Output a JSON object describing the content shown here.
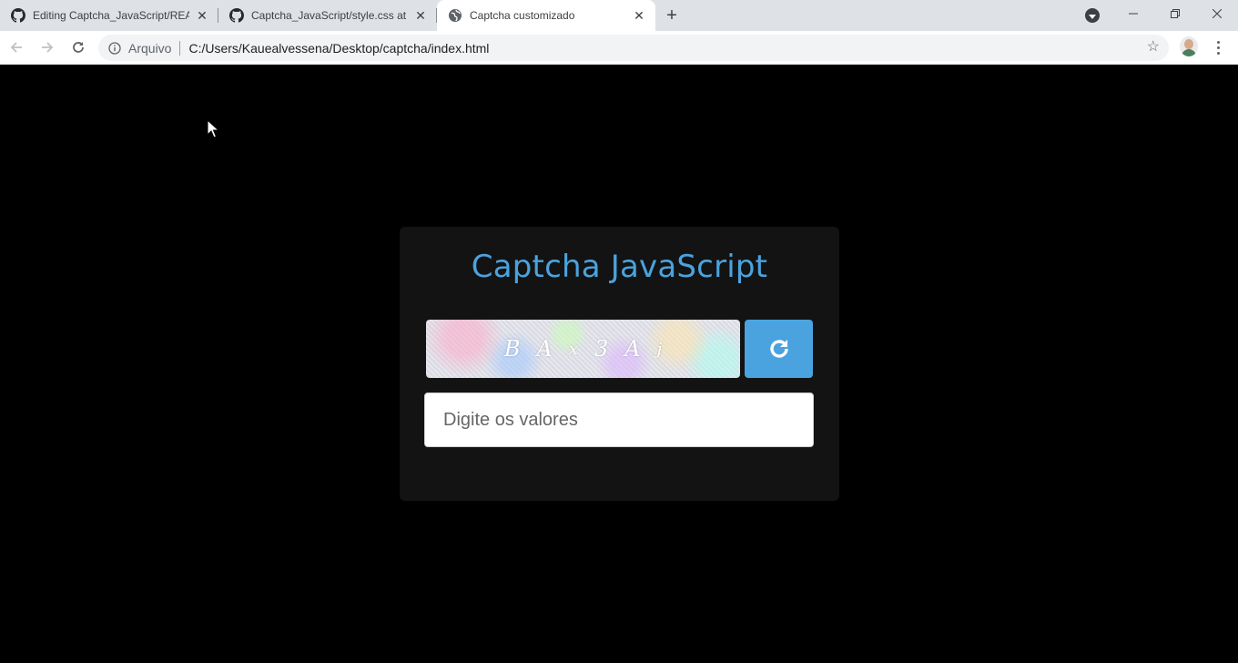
{
  "browser": {
    "tabs": [
      {
        "title": "Editing Captcha_JavaScript/READ",
        "icon": "github-icon",
        "active": false
      },
      {
        "title": "Captcha_JavaScript/style.css at m",
        "icon": "github-icon",
        "active": false
      },
      {
        "title": "Captcha customizado",
        "icon": "globe-icon",
        "active": true
      }
    ],
    "address": {
      "scheme_label": "Arquivo",
      "url": "C:/Users/Kauealvessena/Desktop/captcha/index.html"
    }
  },
  "page": {
    "title": "Captcha JavaScript",
    "captcha_chars": [
      "B",
      "A",
      "x",
      "3",
      "A",
      "j"
    ],
    "input": {
      "placeholder": "Digite os valores",
      "value": ""
    },
    "refresh_icon": "refresh-icon"
  },
  "colors": {
    "accent": "#4aa3df",
    "card_bg": "#131313",
    "page_bg": "#000000"
  }
}
